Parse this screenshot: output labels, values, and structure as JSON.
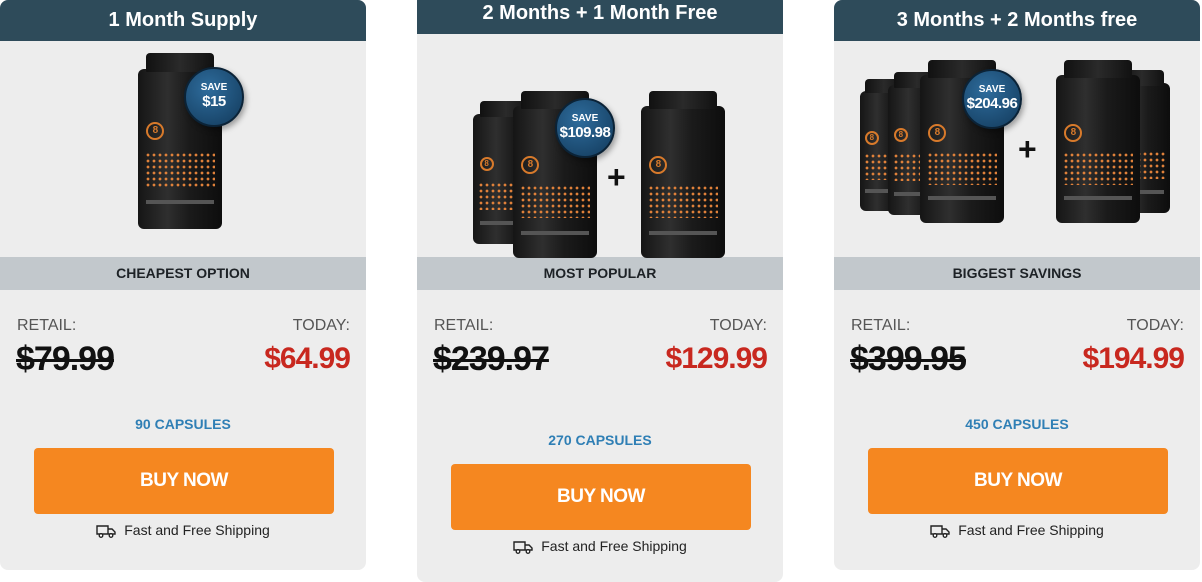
{
  "cards": [
    {
      "header": "1 Month Supply",
      "save_word": "SAVE",
      "save_amount": "$15",
      "label": "CHEAPEST OPTION",
      "retail_label": "RETAIL:",
      "today_label": "TODAY:",
      "retail_price": "$79.99",
      "today_price": "$64.99",
      "capsules": "90 CAPSULES",
      "button": "BUY NOW",
      "shipping": "Fast and Free Shipping"
    },
    {
      "header": "2 Months + 1 Month Free",
      "save_word": "SAVE",
      "save_amount": "$109.98",
      "plus": "+",
      "label": "MOST POPULAR",
      "retail_label": "RETAIL:",
      "today_label": "TODAY:",
      "retail_price": "$239.97",
      "today_price": "$129.99",
      "capsules": "270 CAPSULES",
      "button": "BUY NOW",
      "shipping": "Fast and Free Shipping"
    },
    {
      "header": "3 Months + 2 Months free",
      "save_word": "SAVE",
      "save_amount": "$204.96",
      "plus": "+",
      "label": "BIGGEST SAVINGS",
      "retail_label": "RETAIL:",
      "today_label": "TODAY:",
      "retail_price": "$399.95",
      "today_price": "$194.99",
      "capsules": "450 CAPSULES",
      "button": "BUY NOW",
      "shipping": "Fast and Free Shipping"
    }
  ],
  "icons": {
    "shipping": "delivery-truck-icon",
    "bottle_logo": "8"
  },
  "colors": {
    "header": "#2e4b5a",
    "button": "#f58720",
    "today_price": "#c8281f",
    "capsules": "#2f7fb5",
    "badge": "#1d4f78"
  }
}
